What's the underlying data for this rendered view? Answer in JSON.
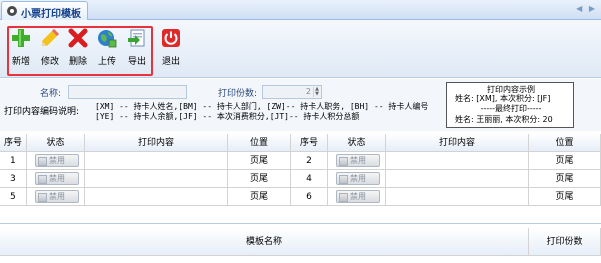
{
  "tab": {
    "title": "小票打印模板",
    "nav": "◀ ▶"
  },
  "toolbar": {
    "add": "新增",
    "edit": "修改",
    "delete": "删除",
    "upload": "上传",
    "export": "导出",
    "exit": "退出"
  },
  "filter": {
    "name_label": "名称:",
    "copies_label": "打印份数:",
    "copies_value": "2",
    "codes_label": "打印内容编码说明:",
    "codes_line1": "[XM] -- 持卡人姓名,[BM] -- 持卡人部门, [ZW]-- 持卡人职务,     [BH] -- 持卡人编号",
    "codes_line2": "[YE] -- 持卡人余额,[JF] -- 本次消费积分,[JT]-- 持卡人积分总额"
  },
  "example": {
    "title": "打印内容示例",
    "line1": "姓名: [XM], 本次积分: [JF]",
    "line2": "-----最终打印-----",
    "line3": "姓名: 王丽丽, 本次积分: 20"
  },
  "grid": {
    "headers": [
      "序号",
      "状态",
      "打印内容",
      "位置",
      "序号",
      "状态",
      "打印内容",
      "位置"
    ],
    "rows": [
      {
        "n1": "1",
        "s1": "禁用",
        "c1": "",
        "p1": "页尾",
        "n2": "2",
        "s2": "禁用",
        "c2": "",
        "p2": "页尾"
      },
      {
        "n1": "3",
        "s1": "禁用",
        "c1": "",
        "p1": "页尾",
        "n2": "4",
        "s2": "禁用",
        "c2": "",
        "p2": "页尾"
      },
      {
        "n1": "5",
        "s1": "禁用",
        "c1": "",
        "p1": "页尾",
        "n2": "6",
        "s2": "禁用",
        "c2": "",
        "p2": "页尾"
      }
    ]
  },
  "lower": {
    "name_header": "模板名称",
    "copies_header": "打印份数"
  },
  "colors": {
    "highlight": "#e8323c",
    "header_text": "#15428b",
    "label_blue": "#2b4a7a"
  }
}
